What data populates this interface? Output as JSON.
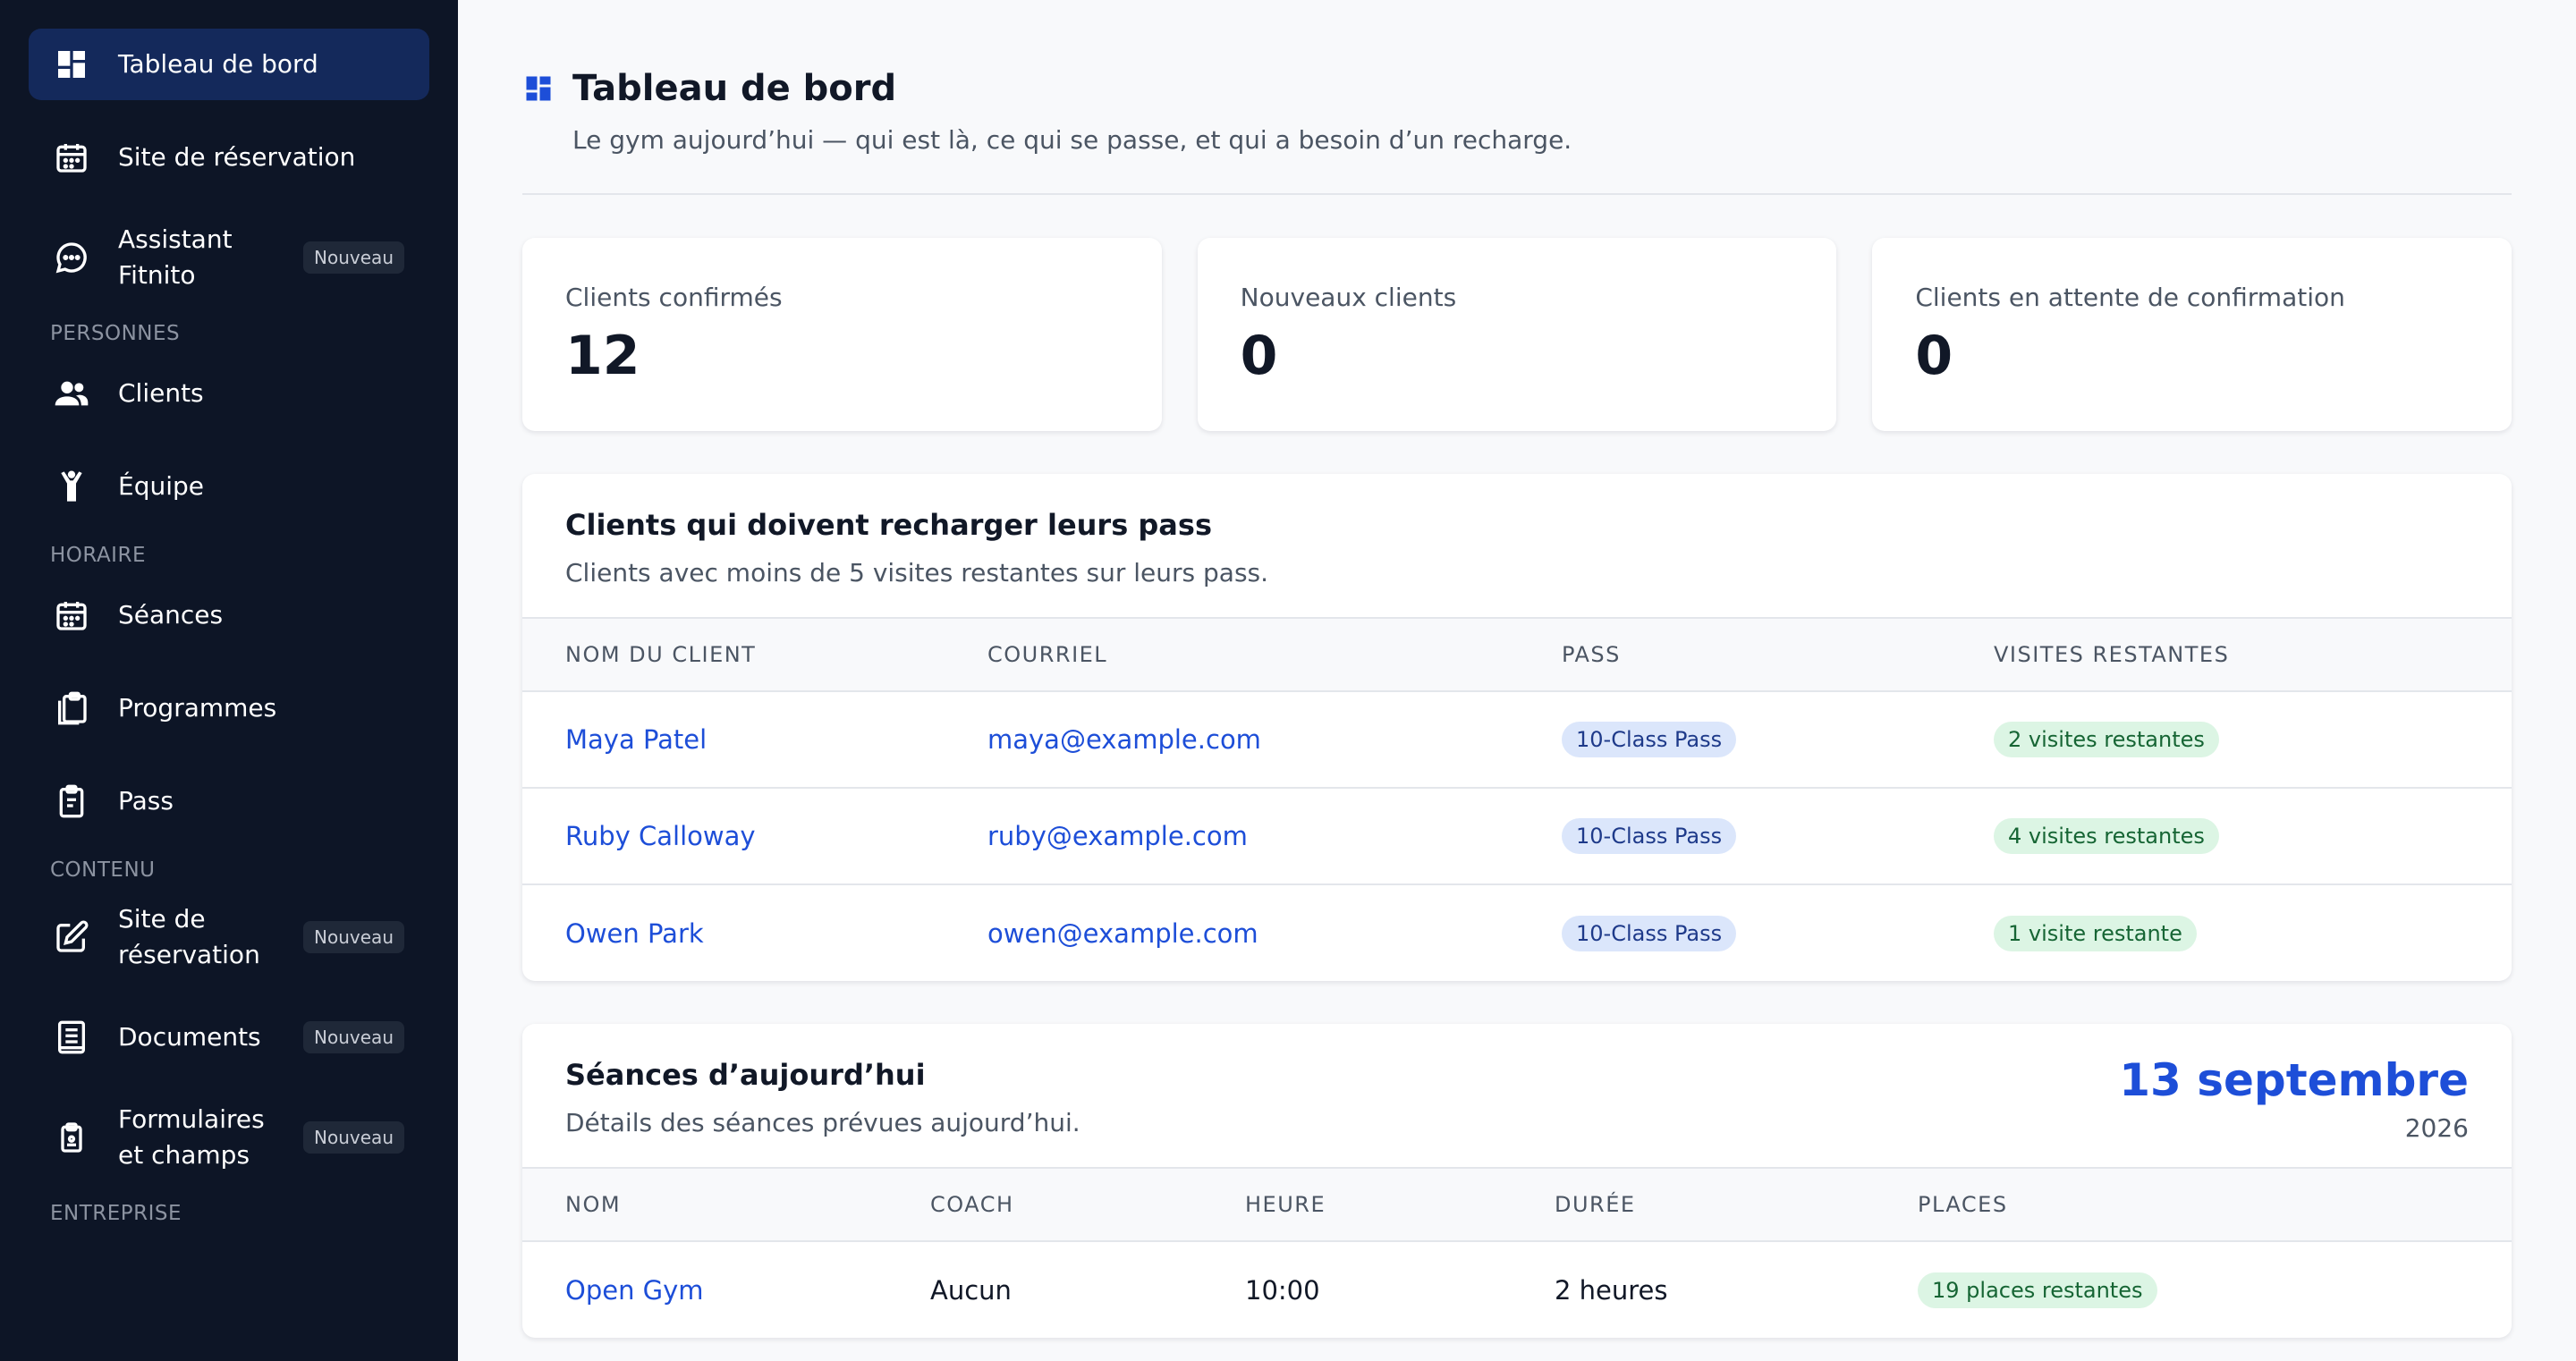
{
  "sidebar": {
    "items": [
      {
        "label": "Tableau de bord"
      },
      {
        "label": "Site de réservation"
      },
      {
        "label": "Assistant Fitnito",
        "badge": "Nouveau"
      },
      {
        "label": "Clients"
      },
      {
        "label": "Équipe"
      },
      {
        "label": "Séances"
      },
      {
        "label": "Programmes"
      },
      {
        "label": "Pass"
      },
      {
        "label": "Site de réservation",
        "badge": "Nouveau"
      },
      {
        "label": "Documents",
        "badge": "Nouveau"
      },
      {
        "label": "Formulaires et champs",
        "badge": "Nouveau"
      }
    ],
    "sections": {
      "personnes": "PERSONNES",
      "horaire": "HORAIRE",
      "contenu": "CONTENU",
      "entreprise": "ENTREPRISE"
    }
  },
  "header": {
    "title": "Tableau de bord",
    "subtitle": "Le gym aujourd’hui — qui est là, ce qui se passe, et qui a besoin d’un recharge."
  },
  "stats": [
    {
      "label": "Clients confirmés",
      "value": "12"
    },
    {
      "label": "Nouveaux clients",
      "value": "0"
    },
    {
      "label": "Clients en attente de confirmation",
      "value": "0"
    }
  ],
  "recharge": {
    "title": "Clients qui doivent recharger leurs pass",
    "description": "Clients avec moins de 5 visites restantes sur leurs pass.",
    "columns": [
      "NOM DU CLIENT",
      "COURRIEL",
      "PASS",
      "VISITES RESTANTES"
    ],
    "rows": [
      {
        "name": "Maya Patel",
        "email": "maya@example.com",
        "pass": "10-Class Pass",
        "remaining": "2 visites restantes"
      },
      {
        "name": "Ruby Calloway",
        "email": "ruby@example.com",
        "pass": "10-Class Pass",
        "remaining": "4 visites restantes"
      },
      {
        "name": "Owen Park",
        "email": "owen@example.com",
        "pass": "10-Class Pass",
        "remaining": "1 visite restante"
      }
    ]
  },
  "sessions": {
    "title": "Séances d’aujourd’hui",
    "description": "Détails des séances prévues aujourd’hui.",
    "date": "13 septembre",
    "year": "2026",
    "columns": [
      "NOM",
      "COACH",
      "HEURE",
      "DURÉE",
      "PLACES"
    ],
    "rows": [
      {
        "name": "Open Gym",
        "coach": "Aucun",
        "time": "10:00",
        "duration": "2 heures",
        "places": "19 places restantes"
      }
    ]
  },
  "colors": {
    "sidebar_bg": "#0d1526",
    "active_bg": "#14295b",
    "accent": "#1d4ed8",
    "pill_blue_bg": "#dbe6fb",
    "pill_green_bg": "#dcf5e4"
  }
}
